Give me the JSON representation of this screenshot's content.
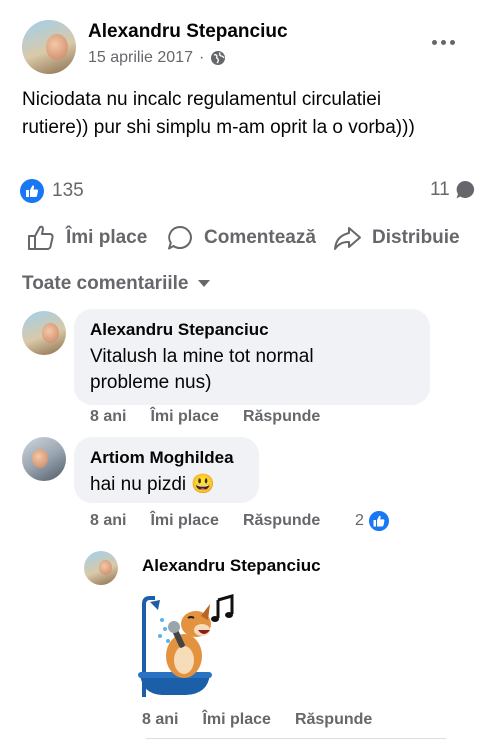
{
  "post": {
    "author": "Alexandru Stepanciuc",
    "date": "15 aprilie 2017",
    "separator": "·",
    "text_line1": "Niciodata nu incalc regulamentul circulatiei",
    "text_line2": "rutiere)) pur shi simplu m-am oprit la o vorba)))",
    "likes_count": "135",
    "comments_count": "11",
    "audience_icon": "globe-icon",
    "menu_icon": "more-icon"
  },
  "actions": {
    "like_label": "Îmi place",
    "comment_label": "Comentează",
    "share_label": "Distribuie"
  },
  "comments_filter": {
    "label": "Toate comentariile"
  },
  "comments": [
    {
      "author": "Alexandru Stepanciuc",
      "text_line1": "Vitalush la mine tot normal",
      "text_line2": "probleme nus)",
      "time": "8 ani",
      "like_label": "Îmi place",
      "reply_label": "Răspunde"
    },
    {
      "author": "Artiom Moghildea",
      "text": "hai nu pizdi 😃",
      "time": "8 ani",
      "like_label": "Îmi place",
      "reply_label": "Răspunde",
      "reactions_count": "2"
    }
  ],
  "reply": {
    "author": "Alexandru Stepanciuc",
    "sticker": "dog-shower-singing-sticker",
    "time": "8 ani",
    "like_label": "Îmi place",
    "reply_label": "Răspunde"
  },
  "colors": {
    "accent": "#1877f2",
    "muted": "#65676b",
    "bubble": "#f0f2f5",
    "text": "#050505"
  }
}
